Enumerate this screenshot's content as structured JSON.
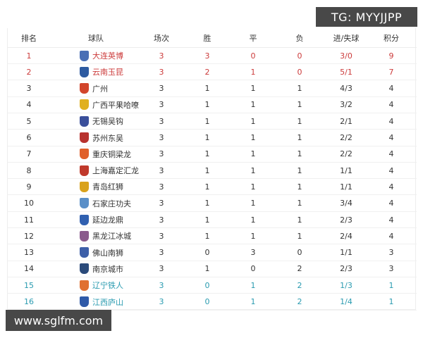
{
  "watermark_top": "TG: MYYJJPP",
  "watermark_bottom": "www.sglfm.com",
  "headers": [
    "排名",
    "球队",
    "场次",
    "胜",
    "平",
    "负",
    "进/失球",
    "积分"
  ],
  "colors": {
    "promotion": "#cc3b3b",
    "relegation": "#2a9bb0",
    "normal": "#333333"
  },
  "rows": [
    {
      "rank": "1",
      "team": "大连英博",
      "played": "3",
      "won": "3",
      "drawn": "0",
      "lost": "0",
      "goals": "3/0",
      "points": "9",
      "status": "promotion",
      "crest_color": "#4a6fb5"
    },
    {
      "rank": "2",
      "team": "云南玉昆",
      "played": "3",
      "won": "2",
      "drawn": "1",
      "lost": "0",
      "goals": "5/1",
      "points": "7",
      "status": "promotion",
      "crest_color": "#2d5aa0"
    },
    {
      "rank": "3",
      "team": "广州",
      "played": "3",
      "won": "1",
      "drawn": "1",
      "lost": "1",
      "goals": "4/3",
      "points": "4",
      "status": "normal",
      "crest_color": "#d2452b"
    },
    {
      "rank": "4",
      "team": "广西平果哈嘹",
      "played": "3",
      "won": "1",
      "drawn": "1",
      "lost": "1",
      "goals": "3/2",
      "points": "4",
      "status": "normal",
      "crest_color": "#e0b020"
    },
    {
      "rank": "5",
      "team": "无锡吴钩",
      "played": "3",
      "won": "1",
      "drawn": "1",
      "lost": "1",
      "goals": "2/1",
      "points": "4",
      "status": "normal",
      "crest_color": "#3a4f9a"
    },
    {
      "rank": "6",
      "team": "苏州东吴",
      "played": "3",
      "won": "1",
      "drawn": "1",
      "lost": "1",
      "goals": "2/2",
      "points": "4",
      "status": "normal",
      "crest_color": "#b8322e"
    },
    {
      "rank": "7",
      "team": "重庆铜梁龙",
      "played": "3",
      "won": "1",
      "drawn": "1",
      "lost": "1",
      "goals": "2/2",
      "points": "4",
      "status": "normal",
      "crest_color": "#e0602a"
    },
    {
      "rank": "8",
      "team": "上海嘉定汇龙",
      "played": "3",
      "won": "1",
      "drawn": "1",
      "lost": "1",
      "goals": "1/1",
      "points": "4",
      "status": "normal",
      "crest_color": "#c0392b"
    },
    {
      "rank": "9",
      "team": "青岛红狮",
      "played": "3",
      "won": "1",
      "drawn": "1",
      "lost": "1",
      "goals": "1/1",
      "points": "4",
      "status": "normal",
      "crest_color": "#d9a21c"
    },
    {
      "rank": "10",
      "team": "石家庄功夫",
      "played": "3",
      "won": "1",
      "drawn": "1",
      "lost": "1",
      "goals": "3/4",
      "points": "4",
      "status": "normal",
      "crest_color": "#5a8fc8"
    },
    {
      "rank": "11",
      "team": "延边龙鼎",
      "played": "3",
      "won": "1",
      "drawn": "1",
      "lost": "1",
      "goals": "2/3",
      "points": "4",
      "status": "normal",
      "crest_color": "#3060b0"
    },
    {
      "rank": "12",
      "team": "黑龙江冰城",
      "played": "3",
      "won": "1",
      "drawn": "1",
      "lost": "1",
      "goals": "2/4",
      "points": "4",
      "status": "normal",
      "crest_color": "#8a5a8c"
    },
    {
      "rank": "13",
      "team": "佛山南狮",
      "played": "3",
      "won": "0",
      "drawn": "3",
      "lost": "0",
      "goals": "1/1",
      "points": "3",
      "status": "normal",
      "crest_color": "#3d5fa8"
    },
    {
      "rank": "14",
      "team": "南京城市",
      "played": "3",
      "won": "1",
      "drawn": "0",
      "lost": "2",
      "goals": "2/3",
      "points": "3",
      "status": "normal",
      "crest_color": "#2a4a7a"
    },
    {
      "rank": "15",
      "team": "辽宁铁人",
      "played": "3",
      "won": "0",
      "drawn": "1",
      "lost": "2",
      "goals": "1/3",
      "points": "1",
      "status": "relegation",
      "crest_color": "#e07030"
    },
    {
      "rank": "16",
      "team": "江西庐山",
      "played": "3",
      "won": "0",
      "drawn": "1",
      "lost": "2",
      "goals": "1/4",
      "points": "1",
      "status": "relegation",
      "crest_color": "#2f5aa8"
    }
  ]
}
